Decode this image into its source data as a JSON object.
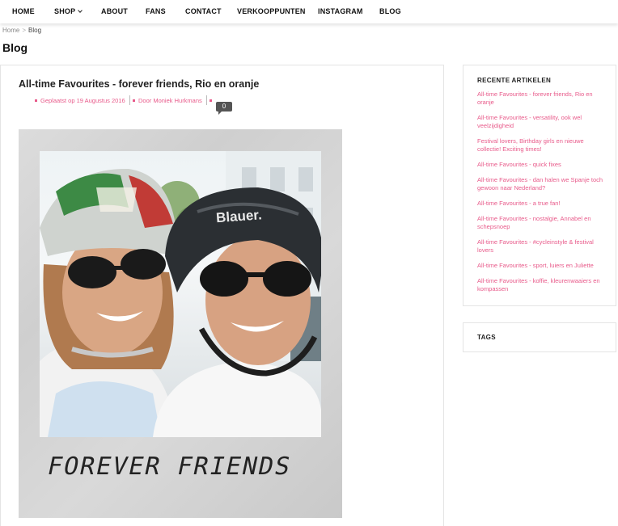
{
  "nav": {
    "items": [
      "HOME",
      "SHOP",
      "ABOUT",
      "FANS",
      "CONTACT",
      "VERKOOPPUNTEN",
      "INSTAGRAM",
      "BLOG"
    ]
  },
  "breadcrumb": {
    "home": "Home",
    "separator": ">",
    "current": "Blog"
  },
  "page": {
    "title": "Blog"
  },
  "post": {
    "title": "All-time Favourites - forever friends, Rio en oranje",
    "posted": "Geplaatst op 19 Augustus 2016",
    "author": "Door Moniek Hurkmans",
    "comments": "0",
    "caption": "FOREVER FRIENDS"
  },
  "sidebar": {
    "recent_title": "RECENTE ARTIKELEN",
    "recent": [
      "All-time Favourites - forever friends, Rio en oranje",
      "All-time Favourites - versatility, ook wel veelzijdigheid",
      "Festival lovers, Birthday girls en nieuwe collectie! Exciting times!",
      "All-time Favourites - quick fixes",
      "All-time Favourites - dan halen we Spanje toch gewoon naar Nederland?",
      "All-time Favourites - a true fan!",
      "All-time Favourites - nostalgie, Annabel en schepsnoep",
      "All-time Favourites - #cycleinstyle & festival lovers",
      "All-time Favourites - sport, luiers en Juliette",
      "All-time Favourites - koffie, kleurenwaaiers en kompassen"
    ],
    "tags_title": "TAGS"
  },
  "colors": {
    "accent": "#e85a8a",
    "text": "#222222",
    "badge": "#555555"
  },
  "icons": {
    "shop_dropdown": "chevron-down-icon",
    "meta_bullet": "square-bullet-icon",
    "comments": "comment-bubble-icon"
  }
}
